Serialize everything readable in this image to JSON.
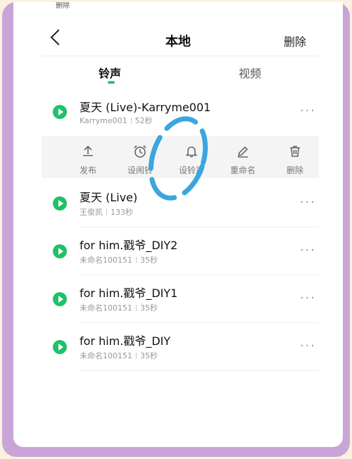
{
  "top_clip_text": "删除",
  "header": {
    "title": "本地",
    "delete_label": "删除"
  },
  "tabs": [
    {
      "label": "铃声"
    },
    {
      "label": "视频"
    }
  ],
  "songs": [
    {
      "title": "夏天 (Live)-Karryme001",
      "artist": "Karryme001",
      "duration": "52秒"
    },
    {
      "title": "夏天 (Live)",
      "artist": "王俊凯",
      "duration": "133秒"
    },
    {
      "title": "for him.戳爷_DIY2",
      "artist": "未命名100151",
      "duration": "35秒"
    },
    {
      "title": "for him.戳爷_DIY1",
      "artist": "未命名100151",
      "duration": "35秒"
    },
    {
      "title": "for him.戳爷_DIY",
      "artist": "未命名100151",
      "duration": "35秒"
    }
  ],
  "more_glyph": "···",
  "actions": [
    {
      "label": "发布",
      "icon": "upload-icon"
    },
    {
      "label": "设闹铃",
      "icon": "alarm-clock-icon"
    },
    {
      "label": "设铃声",
      "icon": "bell-icon"
    },
    {
      "label": "重命名",
      "icon": "pencil-icon"
    },
    {
      "label": "删除",
      "icon": "trash-icon"
    }
  ],
  "colors": {
    "accent_green": "#20c06c",
    "frame_purple": "#c9a4d6",
    "annotation_blue": "#3aa6e0"
  }
}
